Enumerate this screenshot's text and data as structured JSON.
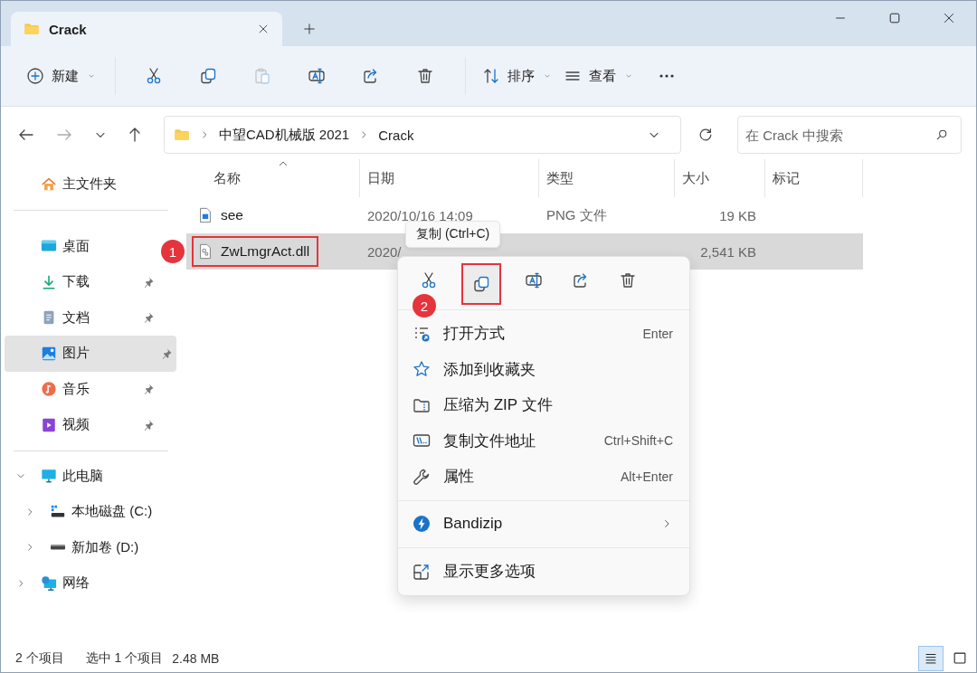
{
  "window": {
    "tab_title": "Crack"
  },
  "toolbar": {
    "new_label": "新建",
    "sort_label": "排序",
    "view_label": "查看",
    "actions": [
      {
        "kind": "cut",
        "disabled": false
      },
      {
        "kind": "copy",
        "disabled": false
      },
      {
        "kind": "paste",
        "disabled": true
      },
      {
        "kind": "rename",
        "disabled": false
      },
      {
        "kind": "share",
        "disabled": false
      },
      {
        "kind": "delete",
        "disabled": false
      }
    ]
  },
  "address": {
    "path": [
      "中望CAD机械版 2021",
      "Crack"
    ],
    "search_placeholder": "在 Crack 中搜索"
  },
  "sidebar": {
    "home": "主文件夹",
    "quick_access": [
      {
        "label": "桌面",
        "kind": "desktop",
        "pinned": false,
        "selected": false
      },
      {
        "label": "下载",
        "kind": "download",
        "pinned": true,
        "selected": false
      },
      {
        "label": "文档",
        "kind": "document",
        "pinned": true,
        "selected": false
      },
      {
        "label": "图片",
        "kind": "pictures",
        "pinned": true,
        "selected": true
      },
      {
        "label": "音乐",
        "kind": "music",
        "pinned": true,
        "selected": false
      },
      {
        "label": "视频",
        "kind": "video",
        "pinned": true,
        "selected": false
      }
    ],
    "tree": [
      {
        "label": "此电脑",
        "kind": "pc",
        "expanded": true,
        "children": [
          {
            "label": "本地磁盘 (C:)",
            "kind": "system-drive",
            "expanded": false
          },
          {
            "label": "新加卷 (D:)",
            "kind": "drive",
            "expanded": false
          }
        ]
      },
      {
        "label": "网络",
        "kind": "network",
        "expanded": false
      }
    ]
  },
  "table": {
    "columns": [
      {
        "label": "名称",
        "sorted": true
      },
      {
        "label": "日期",
        "sorted": false
      },
      {
        "label": "类型",
        "sorted": false
      },
      {
        "label": "大小",
        "sorted": false
      },
      {
        "label": "标记",
        "sorted": false
      }
    ],
    "rows": [
      {
        "name": "see",
        "kind": "image",
        "date": "2020/10/16 14:09",
        "type": "PNG 文件",
        "size": "19 KB",
        "selected": false,
        "outlined": false
      },
      {
        "name": "ZwLmgrAct.dll",
        "kind": "dll",
        "date": "2020/",
        "size": "2,541 KB",
        "selected": true,
        "outlined": true,
        "badge": "1"
      }
    ]
  },
  "tooltip": "复制 (Ctrl+C)",
  "context_menu": {
    "actions": [
      {
        "kind": "cut",
        "outlined": false
      },
      {
        "kind": "copy",
        "outlined": true,
        "badge": "2"
      },
      {
        "kind": "rename",
        "outlined": false
      },
      {
        "kind": "share",
        "outlined": false
      },
      {
        "kind": "delete",
        "outlined": false
      }
    ],
    "sections": [
      [
        {
          "label": "打开方式",
          "kind": "open-with",
          "shortcut": "Enter"
        },
        {
          "label": "添加到收藏夹",
          "kind": "star"
        },
        {
          "label": "压缩为 ZIP 文件",
          "kind": "zip"
        },
        {
          "label": "复制文件地址",
          "kind": "path",
          "shortcut": "Ctrl+Shift+C"
        },
        {
          "label": "属性",
          "kind": "wrench",
          "shortcut": "Alt+Enter"
        }
      ],
      [
        {
          "label": "Bandizip",
          "kind": "bandizip",
          "submenu": true
        }
      ],
      [
        {
          "label": "显示更多选项",
          "kind": "more-options"
        }
      ]
    ]
  },
  "status_bar": {
    "count": "2 个项目",
    "selection": "选中 1 个项目",
    "size": "2.48 MB",
    "views": [
      {
        "kind": "details",
        "selected": true
      },
      {
        "kind": "tiles",
        "selected": false
      }
    ]
  }
}
